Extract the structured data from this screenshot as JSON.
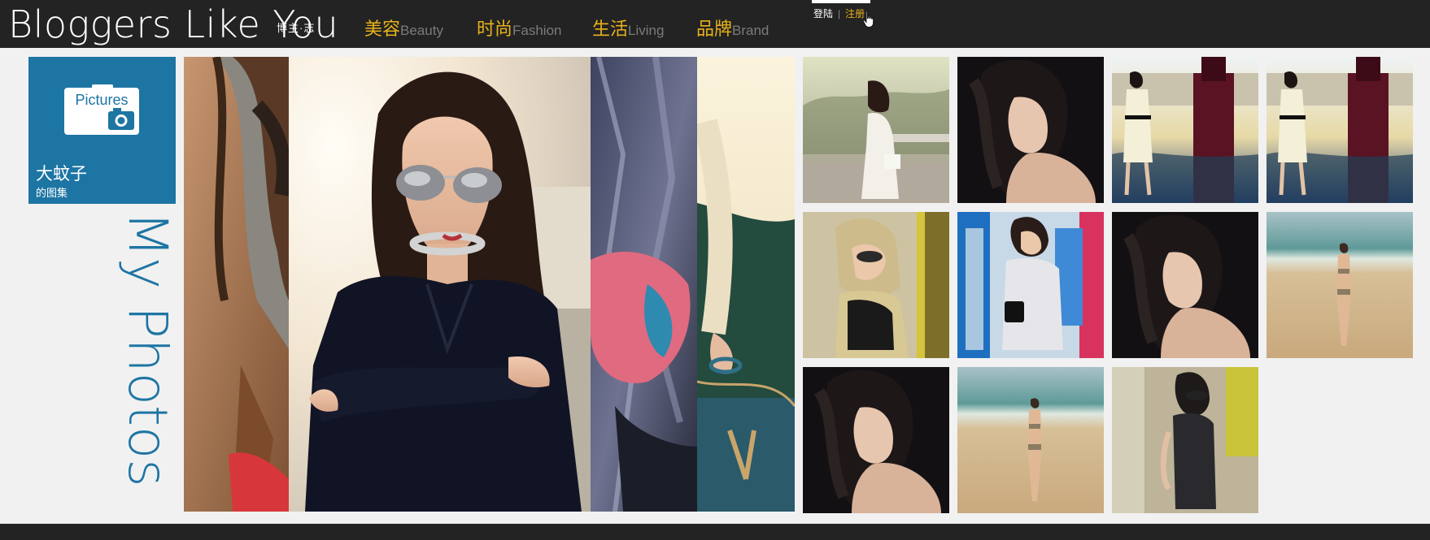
{
  "header": {
    "logo": "Bloggers Like You",
    "logo_sub": "博主·志",
    "nav": [
      {
        "cn": "美容",
        "en": "Beauty"
      },
      {
        "cn": "时尚",
        "en": "Fashion"
      },
      {
        "cn": "生活",
        "en": "Living"
      },
      {
        "cn": "品牌",
        "en": "Brand"
      }
    ],
    "auth": {
      "login": "登陆",
      "separator": "|",
      "register": "注册"
    }
  },
  "album": {
    "icon_label": "Pictures",
    "name": "大蚊子",
    "subtitle": "的图集",
    "vertical_title": "My Photos"
  },
  "colors": {
    "header_bg": "#232323",
    "accent_gold": "#e8b21b",
    "tile_blue": "#1d75a3",
    "page_bg": "#f1f1f1"
  }
}
